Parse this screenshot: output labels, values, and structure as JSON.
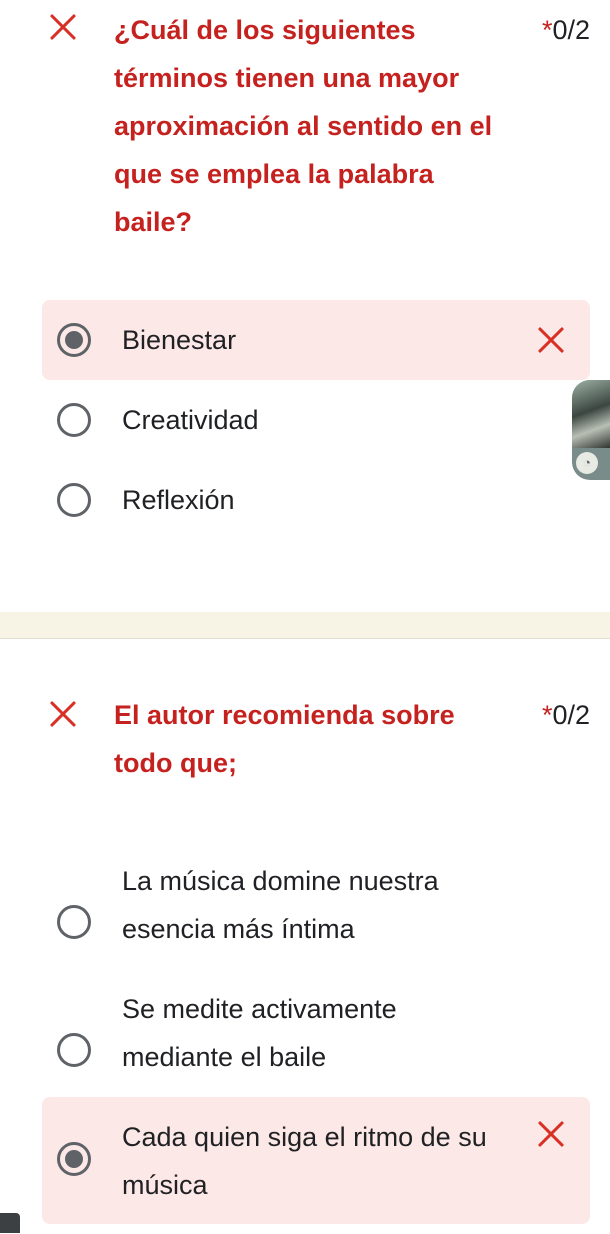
{
  "questions": [
    {
      "title": "¿Cuál de los siguientes términos tienen una mayor aproximación al sentido en el que se emplea la palabra baile?",
      "score_star": "*",
      "score": "0/2",
      "options": [
        {
          "label": "Bienestar",
          "selected": true,
          "incorrect": true
        },
        {
          "label": "Creatividad",
          "selected": false,
          "incorrect": false
        },
        {
          "label": "Reflexión",
          "selected": false,
          "incorrect": false
        }
      ]
    },
    {
      "title": "El autor recomienda sobre todo que;",
      "score_star": "*",
      "score": "0/2",
      "options": [
        {
          "label": "La música domine nuestra esencia más íntima",
          "selected": false,
          "incorrect": false
        },
        {
          "label": "Se medite activamente mediante el baile",
          "selected": false,
          "incorrect": false
        },
        {
          "label": "Cada quien siga el ritmo de su música",
          "selected": true,
          "incorrect": true
        }
      ]
    }
  ],
  "colors": {
    "incorrect_red": "#d93025",
    "title_red": "#c5221f",
    "wrong_bg": "#fce8e6",
    "section_gap": "#f7f4e6"
  },
  "icons": [
    "close-icon",
    "chat-bubble-icon"
  ]
}
